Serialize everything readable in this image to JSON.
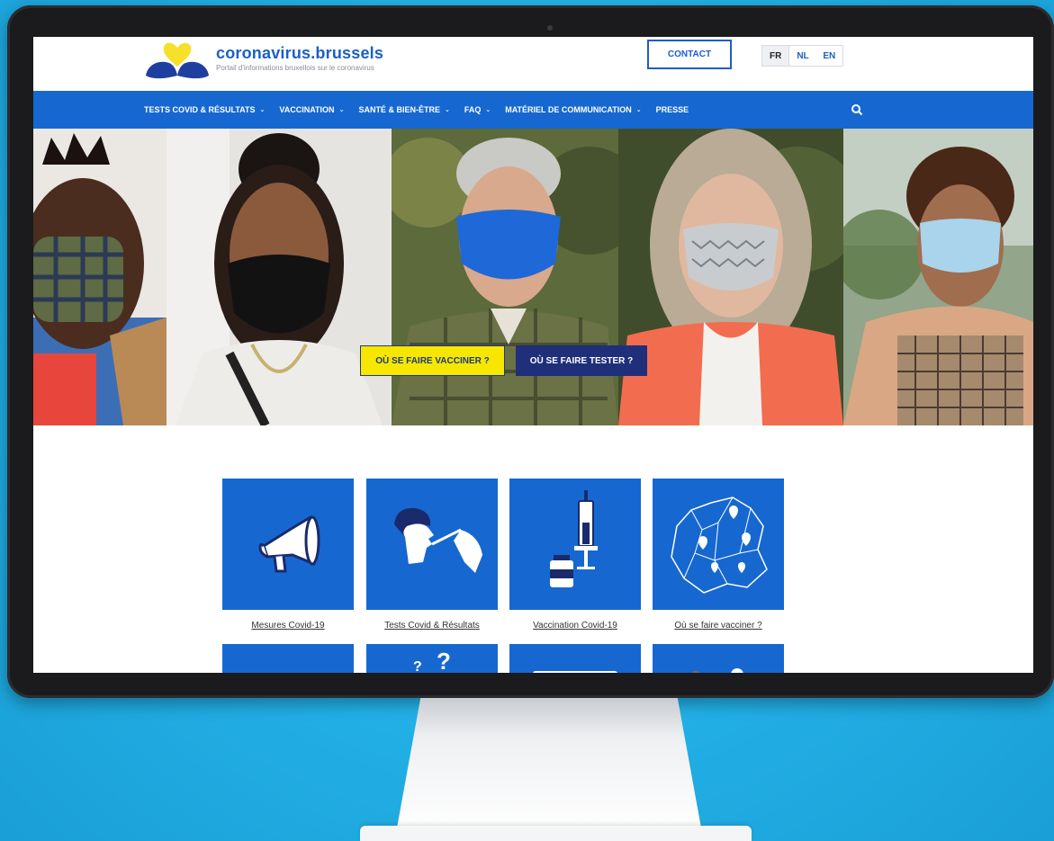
{
  "site": {
    "name": "coronavirus.brussels",
    "tagline": "Portail d'informations bruxellois sur le coronavirus"
  },
  "header": {
    "contact_label": "CONTACT",
    "languages": [
      {
        "code": "FR",
        "active": true
      },
      {
        "code": "NL",
        "active": false
      },
      {
        "code": "EN",
        "active": false
      }
    ]
  },
  "nav": {
    "items": [
      {
        "label": "TESTS COVID & RÉSULTATS",
        "has_dropdown": true
      },
      {
        "label": "VACCINATION",
        "has_dropdown": true
      },
      {
        "label": "SANTÉ & BIEN-ÊTRE",
        "has_dropdown": true
      },
      {
        "label": "FAQ",
        "has_dropdown": true
      },
      {
        "label": "MATÉRIEL DE COMMUNICATION",
        "has_dropdown": true
      },
      {
        "label": "PRESSE",
        "has_dropdown": false
      }
    ],
    "search_icon": "search-icon"
  },
  "hero": {
    "cta_vaccinate": "OÙ SE FAIRE VACCINER ?",
    "cta_test": "OÙ SE FAIRE TESTER ?"
  },
  "tiles": [
    {
      "label": "Mesures Covid-19",
      "icon": "megaphone-icon"
    },
    {
      "label": "Tests Covid & Résultats",
      "icon": "nasal-swab-icon"
    },
    {
      "label": "Vaccination Covid-19",
      "icon": "syringe-vial-icon"
    },
    {
      "label": "Où se faire vacciner ?",
      "icon": "map-pin-icon"
    }
  ],
  "colors": {
    "brand_blue": "#1668d0",
    "cta_yellow": "#f6e600",
    "cta_navy": "#1f2f7a",
    "background_cyan": "#22b0e6"
  }
}
